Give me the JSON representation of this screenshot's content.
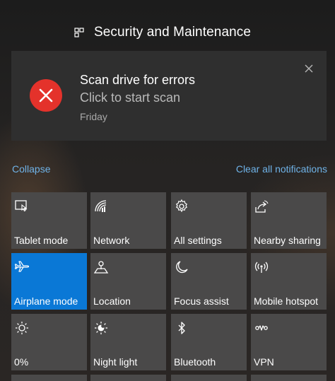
{
  "header": {
    "app_title": "Security and Maintenance",
    "app_icon": "windows-flag-icon"
  },
  "notification": {
    "icon": "error-x-icon",
    "title": "Scan drive for errors",
    "body": "Click to start scan",
    "time": "Friday",
    "close_icon": "close-icon"
  },
  "links": {
    "collapse": "Collapse",
    "clear_all": "Clear all notifications"
  },
  "quick_actions": {
    "tiles": [
      {
        "label": "Tablet mode",
        "icon": "tablet-mode-icon",
        "active": false
      },
      {
        "label": "Network",
        "icon": "network-icon",
        "active": false
      },
      {
        "label": "All settings",
        "icon": "gear-icon",
        "active": false
      },
      {
        "label": "Nearby sharing",
        "icon": "nearby-sharing-icon",
        "active": false
      },
      {
        "label": "Airplane mode",
        "icon": "airplane-icon",
        "active": true
      },
      {
        "label": "Location",
        "icon": "location-icon",
        "active": false
      },
      {
        "label": "Focus assist",
        "icon": "moon-icon",
        "active": false
      },
      {
        "label": "Mobile hotspot",
        "icon": "hotspot-icon",
        "active": false
      },
      {
        "label": "0%",
        "icon": "brightness-icon",
        "active": false
      },
      {
        "label": "Night light",
        "icon": "night-light-icon",
        "active": false
      },
      {
        "label": "Bluetooth",
        "icon": "bluetooth-icon",
        "active": false
      },
      {
        "label": "VPN",
        "icon": "vpn-icon",
        "active": false
      }
    ]
  },
  "colors": {
    "accent": "#0a78d6",
    "tile": "#4a4949",
    "link": "#6fb3e8",
    "error": "#e4322b"
  }
}
